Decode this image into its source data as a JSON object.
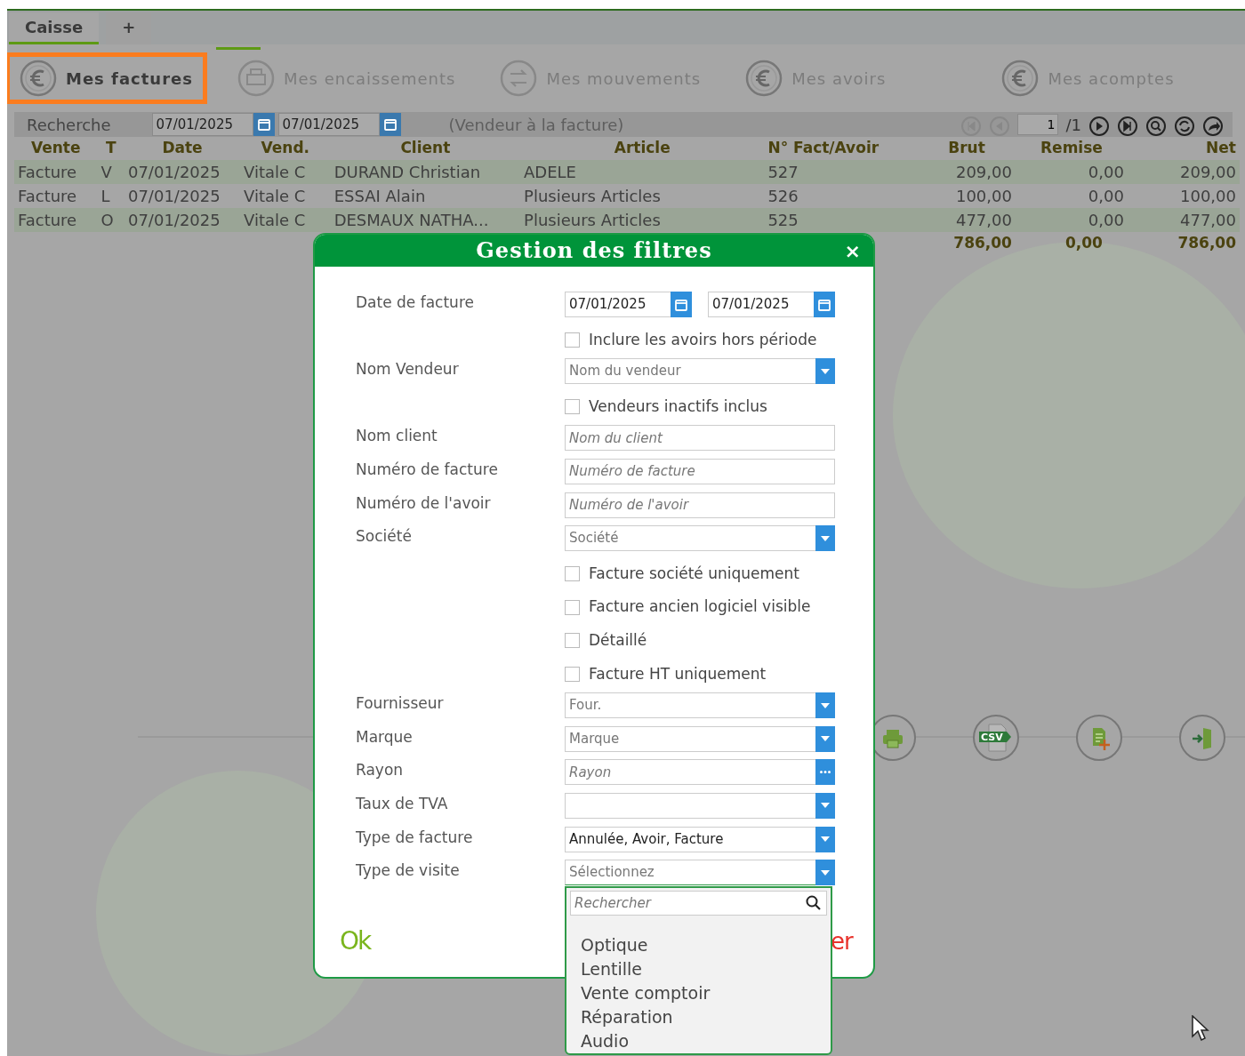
{
  "tabs": [
    {
      "label": "Caisse",
      "selected": true
    },
    {
      "label": "+",
      "selected": false
    }
  ],
  "sections": [
    {
      "label": "Mes factures",
      "kind": "euro",
      "selected": true
    },
    {
      "label": "Mes encaissements",
      "kind": "register",
      "selected": false
    },
    {
      "label": "Mes mouvements",
      "kind": "transfer",
      "selected": false
    },
    {
      "label": "Mes avoirs",
      "kind": "euro",
      "selected": false
    },
    {
      "label": "Mes acomptes",
      "kind": "euro",
      "selected": false
    }
  ],
  "search_bar": {
    "label": "Recherche",
    "date_from": "07/01/2025",
    "date_to": "07/01/2025",
    "note": "(Vendeur à la facture)",
    "page": "1",
    "page_count": "/1"
  },
  "table": {
    "columns": [
      "Vente",
      "T",
      "Date",
      "Vend.",
      "Client",
      "Article",
      "N° Fact/Avoir",
      "Brut",
      "Remise",
      "Net"
    ],
    "rows": [
      [
        "Facture",
        "V",
        "07/01/2025",
        "Vitale C",
        "DURAND Christian",
        "ADELE",
        "527",
        "209,00",
        "0,00",
        "209,00"
      ],
      [
        "Facture",
        "L",
        "07/01/2025",
        "Vitale C",
        "ESSAI Alain",
        "Plusieurs Articles",
        "526",
        "100,00",
        "0,00",
        "100,00"
      ],
      [
        "Facture",
        "O",
        "07/01/2025",
        "Vitale C",
        "DESMAUX NATHA...",
        "Plusieurs Articles",
        "525",
        "477,00",
        "0,00",
        "477,00"
      ]
    ],
    "totals": [
      "786,00",
      "0,00",
      "786,00"
    ]
  },
  "toolbar": [
    {
      "kind": "print"
    },
    {
      "kind": "csv",
      "label": "CSV"
    },
    {
      "kind": "add-document"
    },
    {
      "kind": "exit"
    }
  ],
  "dialog": {
    "title": "Gestion des filtres",
    "close": "×",
    "fields": [
      {
        "kind": "date",
        "label": "Date de facture",
        "values": [
          "07/01/2025",
          "07/01/2025"
        ]
      },
      {
        "kind": "checkbox",
        "label": "Inclure les avoirs hors période",
        "checked": false
      },
      {
        "kind": "select",
        "label": "Nom Vendeur",
        "placeholder": "Nom du vendeur"
      },
      {
        "kind": "checkbox",
        "label": "Vendeurs inactifs inclus",
        "checked": false
      },
      {
        "kind": "text",
        "label": "Nom client",
        "placeholder": "Nom du client"
      },
      {
        "kind": "text",
        "label": "Numéro de facture",
        "placeholder": "Numéro de facture"
      },
      {
        "kind": "text",
        "label": "Numéro de l'avoir",
        "placeholder": "Numéro de l'avoir"
      },
      {
        "kind": "select",
        "label": "Société",
        "placeholder": "Société"
      },
      {
        "kind": "checkbox",
        "label": "Facture société uniquement",
        "checked": false
      },
      {
        "kind": "checkbox",
        "label": "Facture ancien logiciel visible",
        "checked": false
      },
      {
        "kind": "checkbox",
        "label": "Détaillé",
        "checked": false
      },
      {
        "kind": "checkbox",
        "label": "Facture HT uniquement",
        "checked": false
      },
      {
        "kind": "select",
        "label": "Fournisseur",
        "placeholder": "Four."
      },
      {
        "kind": "select",
        "label": "Marque",
        "placeholder": "Marque"
      },
      {
        "kind": "picker",
        "label": "Rayon",
        "placeholder": "Rayon"
      },
      {
        "kind": "select",
        "label": "Taux de TVA"
      },
      {
        "kind": "select",
        "label": "Type de facture",
        "value": "Annulée, Avoir, Facture"
      },
      {
        "kind": "select",
        "label": "Type de visite",
        "placeholder": "Sélectionnez",
        "expanded": true
      }
    ],
    "ok_button": "Ok",
    "cancel_button": "er",
    "dropdown": {
      "placeholder": "Rechercher",
      "options": [
        "Optique",
        "Lentille",
        "Vente comptoir",
        "Réparation",
        "Audio"
      ]
    }
  }
}
